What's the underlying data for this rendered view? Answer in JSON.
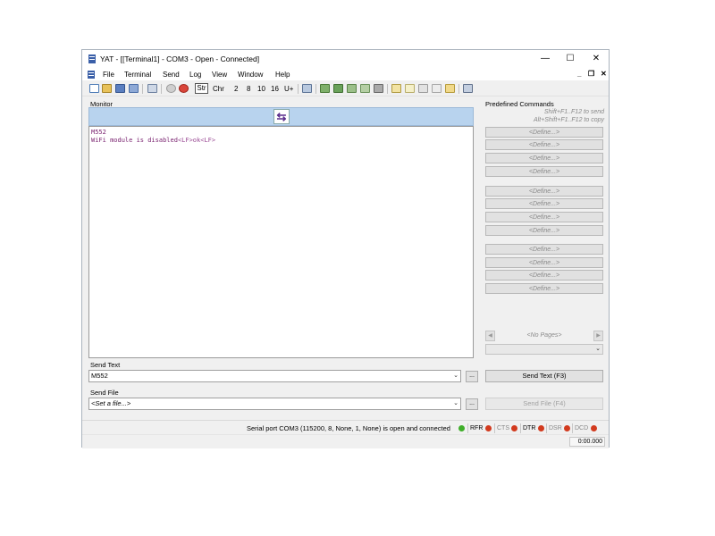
{
  "window": {
    "title": "YAT - [[Terminal1] - COM3 - Open - Connected]",
    "min": "—",
    "max": "☐",
    "close": "✕"
  },
  "menu": {
    "items": [
      "File",
      "Terminal",
      "Send",
      "Log",
      "View",
      "Window",
      "Help"
    ],
    "mdi_min": "_",
    "mdi_restore": "❐",
    "mdi_close": "✕"
  },
  "toolbar": {
    "radix": [
      "Str",
      "Chr",
      "2",
      "8",
      "10",
      "16",
      "U+"
    ]
  },
  "monitor": {
    "label": "Monitor",
    "swap_icon": "⇆",
    "lines": [
      {
        "text": "M552",
        "eol": ""
      },
      {
        "text": "WiFi module is disabled",
        "eol": "<LF>ok<LF>"
      }
    ]
  },
  "predefined": {
    "label": "Predefined Commands",
    "hint_send": "Shift+F1..F12 to send",
    "hint_copy": "Alt+Shift+F1..F12 to copy",
    "define_label": "<Define...>",
    "no_pages": "<No Pages>",
    "prev": "◀",
    "next": "▶"
  },
  "send_text": {
    "label": "Send Text",
    "value": "M552",
    "browse": "...",
    "button": "Send Text (F3)"
  },
  "send_file": {
    "label": "Send File",
    "value": "<Set a file...>",
    "browse": "...",
    "button": "Send File (F4)"
  },
  "status": {
    "text": "Serial port COM3 (115200, 8, None, 1, None) is open and connected",
    "signals": [
      {
        "name": "RFR",
        "color": "#d23a1e"
      },
      {
        "name": "CTS",
        "color": "#d23a1e"
      },
      {
        "name": "DTR",
        "color": "#d23a1e"
      },
      {
        "name": "DSR",
        "color": "#d23a1e"
      },
      {
        "name": "DCD",
        "color": "#d23a1e"
      }
    ],
    "connected_color": "#3fae2a",
    "timer": "0:00.000"
  },
  "colors": {
    "monitor_text": "#7a2370",
    "monitor_header": "#b8d3ee"
  }
}
